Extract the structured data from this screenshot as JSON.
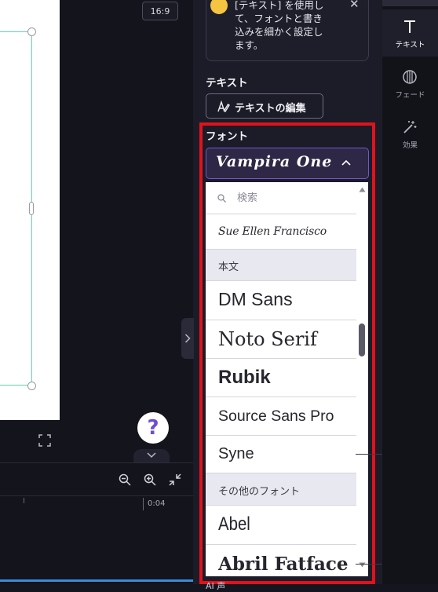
{
  "canvas": {
    "aspect_ratio": "16:9",
    "help_label": "?",
    "timeline_time": "0:04"
  },
  "tip": {
    "text": "[テキスト] を使用し\nて、フォントと書き\n込みを細かく設定し\nます。",
    "close_label": "✕"
  },
  "text_section": {
    "title": "テキスト",
    "edit_button_label": "テキストの編集"
  },
  "font_section": {
    "title": "フォント",
    "selected_font": "Vampira One",
    "search_placeholder": "検索",
    "items": [
      {
        "label": "Sue Ellen Francisco",
        "kind": "font"
      },
      {
        "label": "本文",
        "kind": "group"
      },
      {
        "label": "DM Sans",
        "kind": "font"
      },
      {
        "label": "Noto Serif",
        "kind": "font"
      },
      {
        "label": "Rubik",
        "kind": "font"
      },
      {
        "label": "Source Sans Pro",
        "kind": "font"
      },
      {
        "label": "Syne",
        "kind": "font"
      },
      {
        "label": "その他のフォント",
        "kind": "group"
      },
      {
        "label": "Abel",
        "kind": "font"
      },
      {
        "label": "Abril Fatface",
        "kind": "font"
      }
    ]
  },
  "bottom_label": "AI 声",
  "rail": {
    "text_label": "テキスト",
    "fade_label": "フェード",
    "effects_label": "効果"
  },
  "colors": {
    "accent": "#6d5ad0",
    "highlight": "#e0121c",
    "selection": "#5fd3a7"
  }
}
